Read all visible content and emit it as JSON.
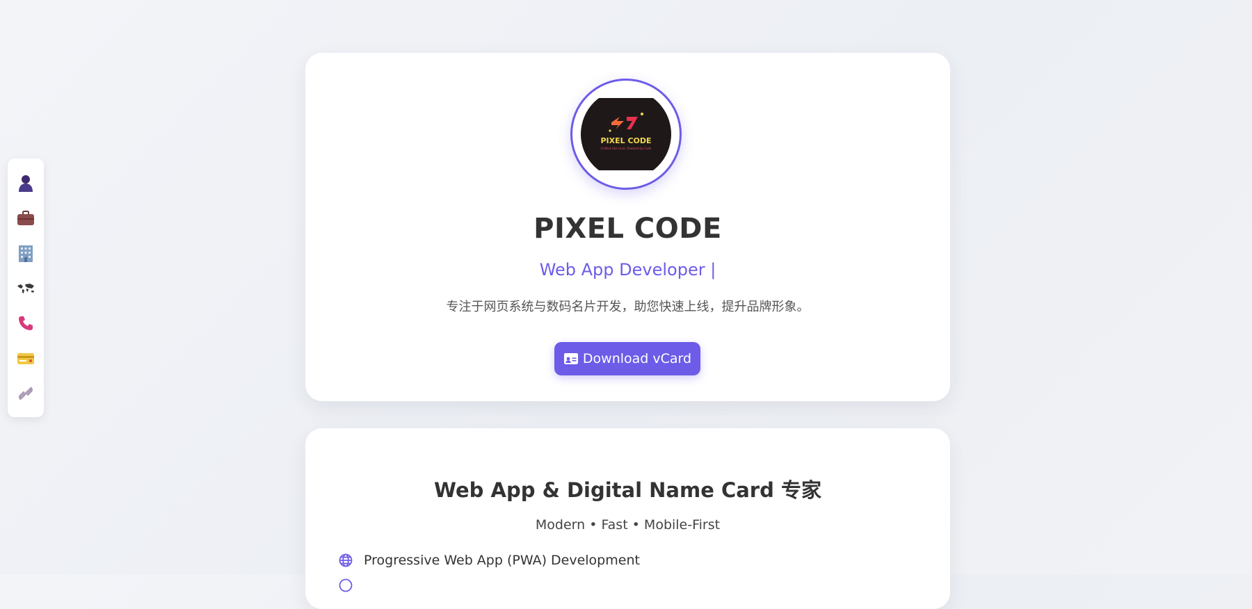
{
  "nav": {
    "items": [
      {
        "icon": "person-icon"
      },
      {
        "icon": "briefcase-icon"
      },
      {
        "icon": "office-building-icon"
      },
      {
        "icon": "world-map-icon"
      },
      {
        "icon": "phone-icon"
      },
      {
        "icon": "id-card-icon"
      },
      {
        "icon": "link-icon"
      }
    ]
  },
  "profile": {
    "logo_text": "PIXEL CODE",
    "logo_sub": "Crafted Like Lines, Powered by Code",
    "name": "PIXEL CODE",
    "role": "Web App Developer |",
    "tagline": "专注于网页系统与数码名片开发，助您快速上线，提升品牌形象。",
    "download_label": "Download vCard"
  },
  "services": {
    "title": "Web App & Digital Name Card 专家",
    "subtitle": "Modern • Fast • Mobile-First",
    "items": [
      {
        "label": "Progressive Web App (PWA) Development",
        "icon": "globe-icon"
      }
    ]
  },
  "colors": {
    "accent": "#6c5ce7",
    "text": "#333333",
    "background": "#eceff4"
  }
}
